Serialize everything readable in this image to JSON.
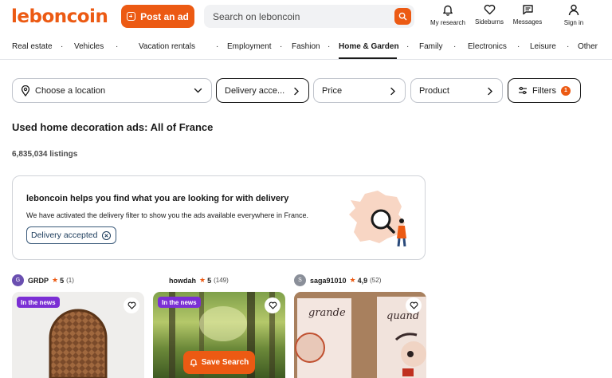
{
  "header": {
    "logo": "leboncoin",
    "post_ad_label": "Post an ad",
    "search_placeholder": "Search on leboncoin",
    "nav": [
      {
        "label": "My research",
        "icon": "bell-icon"
      },
      {
        "label": "Sideburns",
        "icon": "heart-icon"
      },
      {
        "label": "Messages",
        "icon": "message-icon"
      },
      {
        "label": "Sign in",
        "icon": "user-icon"
      }
    ]
  },
  "categories": {
    "items": [
      "Real estate",
      "Vehicles",
      "Vacation rentals",
      "Employment",
      "Fashion",
      "Home & Garden",
      "Family",
      "Electronics",
      "Leisure",
      "Other"
    ],
    "active": "Home & Garden",
    "separator": "·"
  },
  "filters": {
    "location": "Choose a location",
    "delivery": "Delivery acce...",
    "price": "Price",
    "product": "Product",
    "filters": "Filters",
    "filters_count": "1"
  },
  "main": {
    "title": "Used home decoration ads: All of France",
    "listings_count": "6,835,034 listings"
  },
  "delivery_card": {
    "title": "leboncoin helps you find what you are looking for with delivery",
    "text": "We have activated the delivery filter to show you the ads available everywhere in France.",
    "chip": "Delivery accepted"
  },
  "listings": [
    {
      "seller": "GRDP",
      "avatar": "G",
      "avatar_color": "#6a4fb0",
      "rating": "5",
      "reviews": "(1)",
      "badge": "In the news"
    },
    {
      "seller": "howdah",
      "avatar": "🐿",
      "avatar_color": "#ffffff",
      "rating": "5",
      "reviews": "(149)",
      "badge": "In the news"
    },
    {
      "seller": "saga91010",
      "avatar": "S",
      "avatar_color": "#8a8f99",
      "rating": "4,9",
      "reviews": "(52)",
      "badge": ""
    }
  ],
  "save_search_label": "Save Search",
  "colors": {
    "brand": "#ec5a13",
    "news_badge": "#7b2fd4",
    "text": "#1a1a1a"
  }
}
